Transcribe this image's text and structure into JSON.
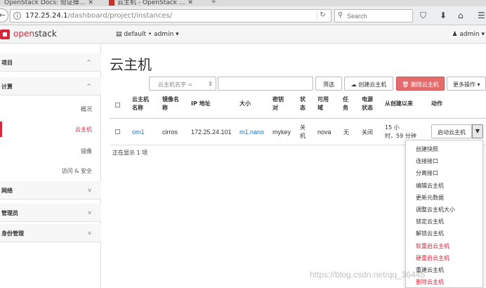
{
  "browser": {
    "tabs": [
      {
        "label": "OpenStack Docs: 验证操..."
      },
      {
        "label": "云主机 - OpenStack ..."
      }
    ],
    "url_host": "172.25.24.1",
    "url_path": "/dashboard/project/instances/",
    "search_placeholder": "Search"
  },
  "header": {
    "logo_prefix": "open",
    "logo_suffix": "stack",
    "project": "default • admin ▾",
    "user": "admin ▾"
  },
  "sidebar": {
    "groups": [
      {
        "label": "项目"
      },
      {
        "label": "计算"
      },
      {
        "label": "网络"
      },
      {
        "label": "管理员"
      },
      {
        "label": "身份管理"
      }
    ],
    "items": [
      {
        "label": "概况"
      },
      {
        "label": "云主机"
      },
      {
        "label": "镜像"
      },
      {
        "label": "访问 & 安全"
      }
    ]
  },
  "main": {
    "title": "云主机",
    "filter_select": "云主机名字 =",
    "filter_button": "筛选",
    "create_button": "创建云主机",
    "delete_button": "删除云主机",
    "more_button": "更多操作 ▾",
    "columns": {
      "name": [
        "云主机",
        "名称"
      ],
      "image": [
        "镜像名",
        "称"
      ],
      "ip": [
        "IP 地址"
      ],
      "size": [
        "大小"
      ],
      "key": [
        "密钥",
        "对"
      ],
      "status": [
        "状",
        "态"
      ],
      "zone": [
        "可用",
        "域"
      ],
      "task": [
        "任",
        "务"
      ],
      "power": [
        "电源",
        "状态"
      ],
      "age": [
        "从创建以来"
      ],
      "actions": [
        "动作"
      ]
    },
    "row": {
      "name": "om1",
      "image": "cirros",
      "ip": "172.25.24.101",
      "size": "m1.nano",
      "key": "mykey",
      "status": [
        "关",
        "机"
      ],
      "zone": "nova",
      "task": "无",
      "power": "关闭",
      "age": [
        "15 小",
        "时，59 分钟"
      ],
      "action": "启动云主机"
    },
    "count_text": "正在显示 1 项"
  },
  "dropdown": {
    "items": [
      {
        "label": "创建快照",
        "danger": false
      },
      {
        "label": "连接接口",
        "danger": false
      },
      {
        "label": "分离接口",
        "danger": false
      },
      {
        "label": "编辑云主机",
        "danger": false
      },
      {
        "label": "更新元数据",
        "danger": false
      },
      {
        "label": "调整云主机大小",
        "danger": false
      },
      {
        "label": "锁定云主机",
        "danger": false
      },
      {
        "label": "解锁云主机",
        "danger": false
      },
      {
        "label": "软重启云主机",
        "danger": true
      },
      {
        "label": "硬重启云主机",
        "danger": true
      },
      {
        "label": "重建云主机",
        "danger": false
      },
      {
        "label": "删除云主机",
        "danger": true
      }
    ]
  },
  "watermark": "https://blog.csdn.net/qq_36445",
  "colors": {
    "accent": "#d6273b",
    "link": "#1f73b7",
    "delete_button": "#e36b6b"
  }
}
